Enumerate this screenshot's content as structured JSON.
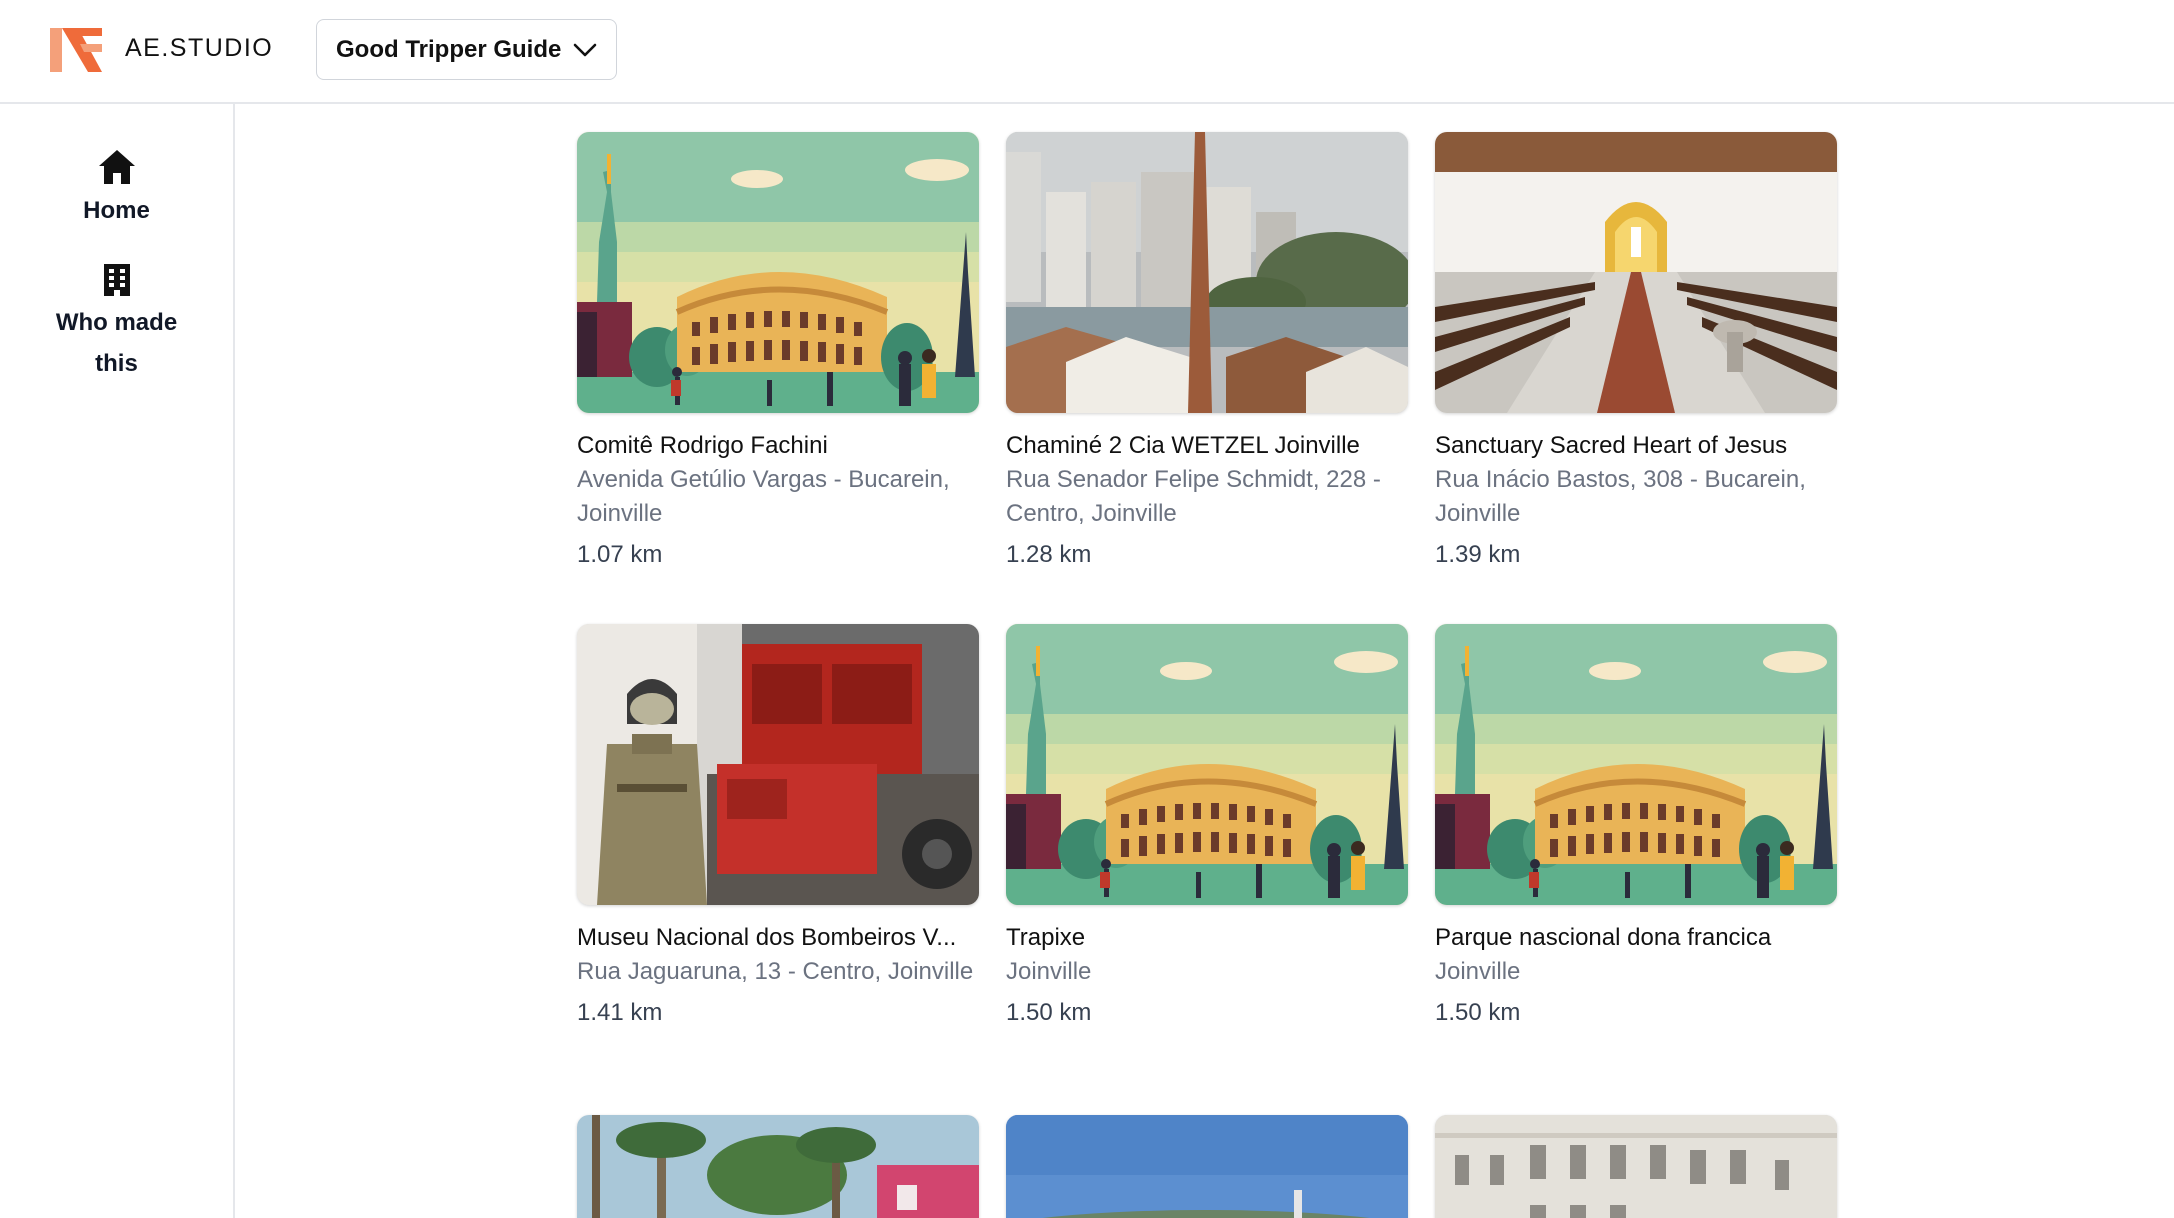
{
  "header": {
    "brand": "AE.STUDIO",
    "app_selector": {
      "selected": "Good Tripper Guide"
    },
    "colors": {
      "logo_primary": "#ef6b3a",
      "logo_secondary": "#f4a07a"
    }
  },
  "sidebar": {
    "items": [
      {
        "label": "Home",
        "icon": "home-icon"
      },
      {
        "label": "Who made this",
        "icon": "building-icon"
      }
    ]
  },
  "places": [
    {
      "name": "Comitê Rodrigo Fachini",
      "address": "Avenida Getúlio Vargas - Bucarein, Joinville",
      "distance": "1.07 km",
      "image": "placeholder-illustration"
    },
    {
      "name": "Chaminé 2 Cia WETZEL Joinville",
      "address": "Rua Senador Felipe Schmidt, 228 - Centro, Joinville",
      "distance": "1.28 km",
      "image": "city-chimney-photo"
    },
    {
      "name": "Sanctuary Sacred Heart of Jesus",
      "address": "Rua Inácio Bastos, 308 - Bucarein, Joinville",
      "distance": "1.39 km",
      "image": "church-interior-photo"
    },
    {
      "name": "Museu Nacional dos Bombeiros V...",
      "address": "Rua Jaguaruna, 13 - Centro, Joinville",
      "distance": "1.41 km",
      "image": "fire-museum-photo"
    },
    {
      "name": "Trapixe",
      "address": "Joinville",
      "distance": "1.50 km",
      "image": "placeholder-illustration"
    },
    {
      "name": "Parque nascional dona francica",
      "address": "Joinville",
      "distance": "1.50 km",
      "image": "placeholder-illustration"
    }
  ],
  "partial_places": [
    {
      "image": "palm-trees-photo"
    },
    {
      "image": "sky-photo"
    },
    {
      "image": "historic-building-photo"
    }
  ]
}
